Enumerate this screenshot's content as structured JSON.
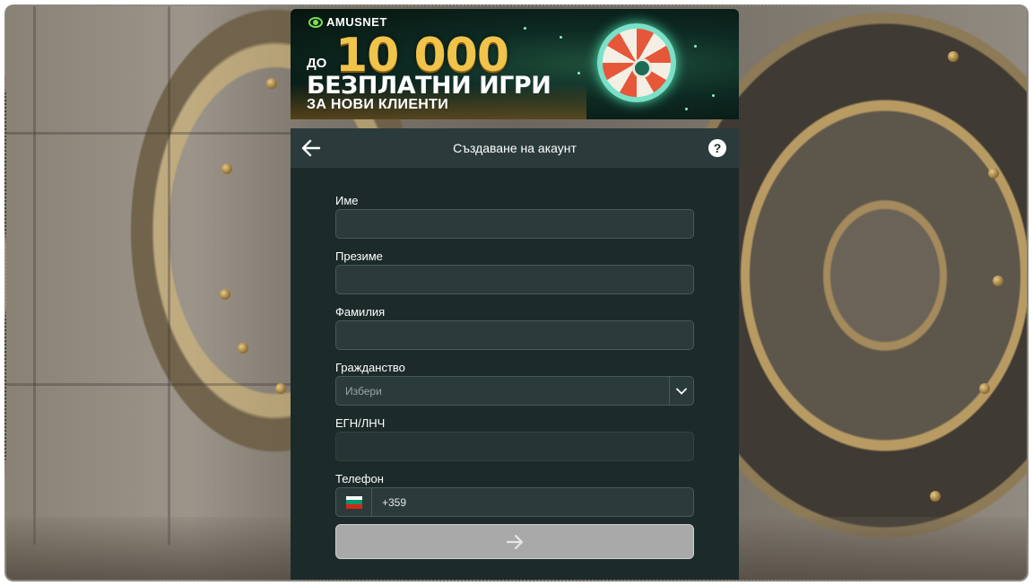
{
  "banner": {
    "brand": "AMUSNET",
    "promo_prefix": "ДО",
    "promo_amount": "10 000",
    "promo_line1": "БЕЗПЛАТНИ ИГРИ",
    "promo_line2": "ЗА НОВИ КЛИЕНТИ",
    "accent_color": "#f0c34a"
  },
  "modal": {
    "title": "Създаване на акаунт",
    "help_label": "?",
    "background_color": "#1c2a2a",
    "header_color": "#2b3b3b"
  },
  "form": {
    "first_name": {
      "label": "Име",
      "value": ""
    },
    "middle_name": {
      "label": "Презиме",
      "value": ""
    },
    "last_name": {
      "label": "Фамилия",
      "value": ""
    },
    "citizenship": {
      "label": "Гражданство",
      "selected": "Избери"
    },
    "egn": {
      "label": "ЕГН/ЛНЧ",
      "value": ""
    },
    "phone": {
      "label": "Телефон",
      "prefix": "+359",
      "country_flag": "bulgaria-flag"
    },
    "submit": {
      "icon": "arrow-right-icon",
      "color": "#a9a9a9"
    }
  }
}
